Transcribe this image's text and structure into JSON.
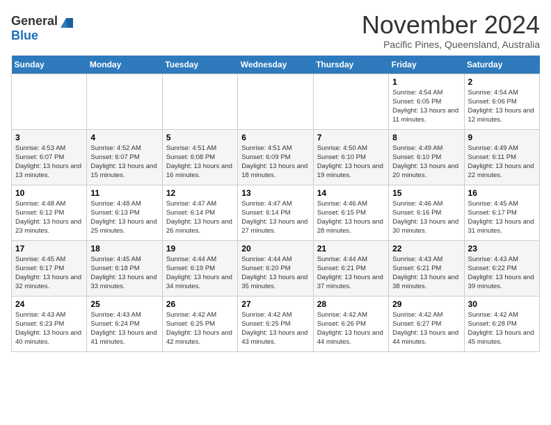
{
  "logo": {
    "general": "General",
    "blue": "Blue"
  },
  "title": "November 2024",
  "location": "Pacific Pines, Queensland, Australia",
  "days_of_week": [
    "Sunday",
    "Monday",
    "Tuesday",
    "Wednesday",
    "Thursday",
    "Friday",
    "Saturday"
  ],
  "weeks": [
    [
      {
        "day": "",
        "info": ""
      },
      {
        "day": "",
        "info": ""
      },
      {
        "day": "",
        "info": ""
      },
      {
        "day": "",
        "info": ""
      },
      {
        "day": "",
        "info": ""
      },
      {
        "day": "1",
        "info": "Sunrise: 4:54 AM\nSunset: 6:05 PM\nDaylight: 13 hours and 11 minutes."
      },
      {
        "day": "2",
        "info": "Sunrise: 4:54 AM\nSunset: 6:06 PM\nDaylight: 13 hours and 12 minutes."
      }
    ],
    [
      {
        "day": "3",
        "info": "Sunrise: 4:53 AM\nSunset: 6:07 PM\nDaylight: 13 hours and 13 minutes."
      },
      {
        "day": "4",
        "info": "Sunrise: 4:52 AM\nSunset: 6:07 PM\nDaylight: 13 hours and 15 minutes."
      },
      {
        "day": "5",
        "info": "Sunrise: 4:51 AM\nSunset: 6:08 PM\nDaylight: 13 hours and 16 minutes."
      },
      {
        "day": "6",
        "info": "Sunrise: 4:51 AM\nSunset: 6:09 PM\nDaylight: 13 hours and 18 minutes."
      },
      {
        "day": "7",
        "info": "Sunrise: 4:50 AM\nSunset: 6:10 PM\nDaylight: 13 hours and 19 minutes."
      },
      {
        "day": "8",
        "info": "Sunrise: 4:49 AM\nSunset: 6:10 PM\nDaylight: 13 hours and 20 minutes."
      },
      {
        "day": "9",
        "info": "Sunrise: 4:49 AM\nSunset: 6:11 PM\nDaylight: 13 hours and 22 minutes."
      }
    ],
    [
      {
        "day": "10",
        "info": "Sunrise: 4:48 AM\nSunset: 6:12 PM\nDaylight: 13 hours and 23 minutes."
      },
      {
        "day": "11",
        "info": "Sunrise: 4:48 AM\nSunset: 6:13 PM\nDaylight: 13 hours and 25 minutes."
      },
      {
        "day": "12",
        "info": "Sunrise: 4:47 AM\nSunset: 6:14 PM\nDaylight: 13 hours and 26 minutes."
      },
      {
        "day": "13",
        "info": "Sunrise: 4:47 AM\nSunset: 6:14 PM\nDaylight: 13 hours and 27 minutes."
      },
      {
        "day": "14",
        "info": "Sunrise: 4:46 AM\nSunset: 6:15 PM\nDaylight: 13 hours and 28 minutes."
      },
      {
        "day": "15",
        "info": "Sunrise: 4:46 AM\nSunset: 6:16 PM\nDaylight: 13 hours and 30 minutes."
      },
      {
        "day": "16",
        "info": "Sunrise: 4:45 AM\nSunset: 6:17 PM\nDaylight: 13 hours and 31 minutes."
      }
    ],
    [
      {
        "day": "17",
        "info": "Sunrise: 4:45 AM\nSunset: 6:17 PM\nDaylight: 13 hours and 32 minutes."
      },
      {
        "day": "18",
        "info": "Sunrise: 4:45 AM\nSunset: 6:18 PM\nDaylight: 13 hours and 33 minutes."
      },
      {
        "day": "19",
        "info": "Sunrise: 4:44 AM\nSunset: 6:19 PM\nDaylight: 13 hours and 34 minutes."
      },
      {
        "day": "20",
        "info": "Sunrise: 4:44 AM\nSunset: 6:20 PM\nDaylight: 13 hours and 35 minutes."
      },
      {
        "day": "21",
        "info": "Sunrise: 4:44 AM\nSunset: 6:21 PM\nDaylight: 13 hours and 37 minutes."
      },
      {
        "day": "22",
        "info": "Sunrise: 4:43 AM\nSunset: 6:21 PM\nDaylight: 13 hours and 38 minutes."
      },
      {
        "day": "23",
        "info": "Sunrise: 4:43 AM\nSunset: 6:22 PM\nDaylight: 13 hours and 39 minutes."
      }
    ],
    [
      {
        "day": "24",
        "info": "Sunrise: 4:43 AM\nSunset: 6:23 PM\nDaylight: 13 hours and 40 minutes."
      },
      {
        "day": "25",
        "info": "Sunrise: 4:43 AM\nSunset: 6:24 PM\nDaylight: 13 hours and 41 minutes."
      },
      {
        "day": "26",
        "info": "Sunrise: 4:42 AM\nSunset: 6:25 PM\nDaylight: 13 hours and 42 minutes."
      },
      {
        "day": "27",
        "info": "Sunrise: 4:42 AM\nSunset: 6:25 PM\nDaylight: 13 hours and 43 minutes."
      },
      {
        "day": "28",
        "info": "Sunrise: 4:42 AM\nSunset: 6:26 PM\nDaylight: 13 hours and 44 minutes."
      },
      {
        "day": "29",
        "info": "Sunrise: 4:42 AM\nSunset: 6:27 PM\nDaylight: 13 hours and 44 minutes."
      },
      {
        "day": "30",
        "info": "Sunrise: 4:42 AM\nSunset: 6:28 PM\nDaylight: 13 hours and 45 minutes."
      }
    ]
  ]
}
